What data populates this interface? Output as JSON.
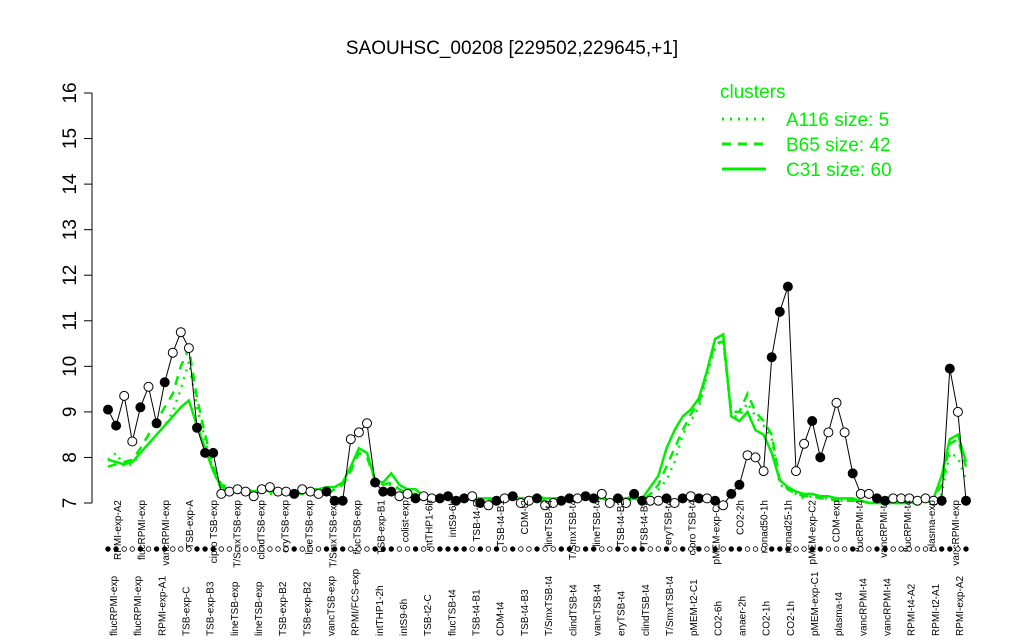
{
  "chart_data": {
    "type": "line",
    "title": "SAOUHSC_00208 [229502,229645,+1]",
    "ylim": [
      7,
      16
    ],
    "yticks": [
      7,
      8,
      9,
      10,
      11,
      12,
      13,
      14,
      15,
      16
    ],
    "legend": {
      "title": "clusters",
      "placement": "top-right",
      "entries": [
        {
          "label": "A116 size: 5",
          "style": "dotted"
        },
        {
          "label": "B65 size: 42",
          "style": "dashed"
        },
        {
          "label": "C31 size: 60",
          "style": "solid"
        }
      ],
      "color": "#00ee00"
    },
    "top_labels": [
      "RPMI-exp-A2",
      "flucRPMI-exp",
      "vancRPMI-exp",
      "TSB-exp-A",
      "cipro TSB-exp",
      "T/SmxTSB-exp",
      "clindTSB-exp",
      "eryTSB-exp",
      "lineTSB-exp",
      "T/SmxTSB-exp",
      "flucTSB-exp",
      "TSB-exp-B1",
      "colist-exp",
      "intTHP1-6h",
      "intS9-6h",
      "TSB-t4-C",
      "TSB-t4-B1",
      "CDM-t2",
      "lineTSB-t4",
      "T/SmxTSB-t4",
      "lineTSB-t4",
      "TSB-t4-B2",
      "TSB-t4-B3",
      "eryTSB-t4",
      "cipro TSB-t4",
      "pMEM-exp-C1",
      "CO2-2h",
      "nonad50-1h",
      "nonad25-1h",
      "pMEM-exp-C2",
      "CDM-exp",
      "flucRPMI-t4",
      "vancRPMI-t4",
      "flucRPMI-t4",
      "plasma-exp",
      "vancRPMI-exp"
    ],
    "bottom_labels": [
      "flucRPMI-exp",
      "flucRPMI-exp",
      "RPMI-exp-A1",
      "TSB-exp-C",
      "TSB-exp-B3",
      "lineTSB-exp",
      "lineTSB-exp",
      "TSB-exp-B2",
      "TSB-exp-B2",
      "vancTSB-exp",
      "RPMI/FCS-exp",
      "intTHP1-2h",
      "intS9-6h",
      "TSB-t2-C",
      "flucTSB-t4",
      "TSB-t4-B1",
      "CDM-t4",
      "TSB-t4-B3",
      "T/SmxTSB-t4",
      "clindTSB-t4",
      "vancTSB-t4",
      "eryTSB-t4",
      "clindTSB-t4",
      "T/SmxTSB-t4",
      "pMEM-t2-C1",
      "CO2-6h",
      "anaer-2h",
      "CO2-1h",
      "CO2-1h",
      "pMEM-exp-C1",
      "plasma-t4",
      "vancRPMI-t4",
      "vancRPMI-t4",
      "RPMI-t4-A2",
      "RPMI-t2-A1",
      "RPMI-exp-A2"
    ],
    "x": [
      1,
      2,
      3,
      4,
      5,
      6,
      7,
      8,
      9,
      10,
      11,
      12,
      13,
      14,
      15,
      16,
      17,
      18,
      19,
      20,
      21,
      22,
      23,
      24,
      25,
      26,
      27,
      28,
      29,
      30,
      31,
      32,
      33,
      34,
      35,
      36,
      37,
      38,
      39,
      40,
      41,
      42,
      43,
      44,
      45,
      46,
      47,
      48,
      49,
      50,
      51,
      52,
      53,
      54,
      55,
      56,
      57,
      58,
      59,
      60,
      61,
      62,
      63,
      64,
      65,
      66,
      67,
      68,
      69,
      70,
      71,
      72,
      73,
      74,
      75,
      76,
      77,
      78,
      79,
      80,
      81,
      82,
      83,
      84,
      85,
      86,
      87,
      88,
      89,
      90,
      91,
      92,
      93,
      94,
      95,
      96,
      97,
      98,
      99,
      100,
      101,
      102,
      103,
      104,
      105,
      106,
      107
    ],
    "sample_values": [
      9.05,
      8.7,
      9.35,
      8.35,
      9.1,
      9.55,
      8.75,
      9.65,
      10.3,
      10.75,
      10.4,
      8.65,
      8.1,
      8.1,
      7.2,
      7.25,
      7.3,
      7.25,
      7.15,
      7.3,
      7.35,
      7.25,
      7.25,
      7.2,
      7.3,
      7.25,
      7.2,
      7.25,
      7.05,
      7.05,
      8.4,
      8.55,
      8.75,
      7.45,
      7.25,
      7.25,
      7.15,
      7.2,
      7.1,
      7.15,
      7.1,
      7.1,
      7.15,
      7.05,
      7.1,
      7.15,
      7.0,
      6.95,
      7.05,
      7.1,
      7.15,
      7.0,
      7.05,
      7.1,
      6.95,
      7.0,
      7.05,
      7.1,
      7.1,
      7.15,
      7.1,
      7.2,
      7.0,
      7.1,
      7.0,
      7.2,
      7.05,
      7.05,
      7.05,
      7.1,
      7.0,
      7.1,
      7.15,
      7.1,
      7.1,
      7.05,
      6.95,
      7.2,
      7.4,
      8.05,
      8.0,
      7.7,
      10.2,
      11.2,
      11.75,
      7.7,
      8.3,
      8.8,
      8.0,
      8.55,
      9.2,
      8.55,
      7.65,
      7.2,
      7.2,
      7.1,
      7.05,
      7.1,
      7.1,
      7.1,
      7.05,
      7.1,
      7.05,
      7.05,
      9.95,
      9.0,
      7.05
    ],
    "series": [
      {
        "name": "A116 size: 5",
        "style": "dotted",
        "values": [
          7.95,
          8.1,
          7.8,
          7.85,
          8.1,
          8.3,
          8.5,
          8.7,
          9.0,
          9.5,
          10.1,
          9.1,
          8.4,
          7.7,
          7.3,
          7.3,
          7.25,
          7.25,
          7.2,
          7.25,
          7.2,
          7.2,
          7.2,
          7.2,
          7.2,
          7.2,
          7.2,
          7.2,
          7.3,
          7.4,
          7.7,
          8.2,
          8.1,
          7.5,
          7.4,
          7.4,
          7.3,
          7.2,
          7.2,
          7.1,
          7.1,
          7.1,
          7.1,
          7.1,
          7.05,
          7.05,
          7.05,
          7.05,
          7.1,
          7.05,
          7.1,
          7.05,
          7.05,
          7.1,
          7.05,
          7.05,
          7.05,
          7.1,
          7.05,
          7.1,
          7.1,
          7.1,
          7.05,
          7.05,
          7.05,
          7.1,
          7.05,
          7.2,
          7.3,
          7.5,
          7.9,
          8.5,
          8.8,
          9.1,
          9.8,
          10.4,
          10.6,
          8.9,
          8.9,
          9.2,
          8.9,
          8.7,
          8.4,
          7.4,
          7.3,
          7.2,
          7.1,
          7.15,
          7.1,
          7.1,
          7.05,
          7.05,
          7.05,
          7.05,
          7.0,
          7.0,
          7.0,
          7.0,
          7.0,
          7.0,
          7.0,
          7.05,
          7.0,
          7.2,
          8.1,
          8.0,
          7.5
        ]
      },
      {
        "name": "B65 size: 42",
        "style": "dashed",
        "values": [
          7.8,
          7.85,
          7.9,
          7.95,
          8.2,
          8.5,
          8.8,
          9.1,
          9.4,
          10.0,
          10.4,
          9.3,
          8.5,
          7.8,
          7.4,
          7.35,
          7.3,
          7.3,
          7.25,
          7.3,
          7.25,
          7.2,
          7.25,
          7.2,
          7.2,
          7.2,
          7.2,
          7.2,
          7.3,
          7.4,
          7.7,
          8.1,
          8.0,
          7.5,
          7.4,
          7.45,
          7.3,
          7.2,
          7.2,
          7.1,
          7.1,
          7.1,
          7.1,
          7.1,
          7.05,
          7.05,
          7.05,
          7.05,
          7.1,
          7.05,
          7.1,
          7.05,
          7.05,
          7.1,
          7.05,
          7.05,
          7.05,
          7.1,
          7.05,
          7.1,
          7.1,
          7.1,
          7.05,
          7.05,
          7.05,
          7.1,
          7.05,
          7.2,
          7.4,
          7.8,
          8.2,
          8.6,
          8.95,
          9.2,
          9.9,
          10.5,
          10.55,
          9.0,
          9.0,
          9.4,
          9.0,
          8.8,
          8.5,
          7.5,
          7.3,
          7.2,
          7.15,
          7.15,
          7.1,
          7.1,
          7.05,
          7.05,
          7.05,
          7.05,
          7.0,
          7.0,
          7.0,
          7.0,
          7.0,
          7.0,
          7.05,
          7.05,
          7.1,
          7.4,
          8.3,
          8.4,
          7.8
        ]
      },
      {
        "name": "C31 size: 60",
        "style": "solid",
        "values": [
          7.95,
          7.9,
          7.85,
          7.9,
          8.1,
          8.3,
          8.5,
          8.7,
          8.9,
          9.1,
          9.25,
          8.7,
          8.2,
          7.7,
          7.35,
          7.3,
          7.3,
          7.3,
          7.25,
          7.3,
          7.25,
          7.25,
          7.25,
          7.25,
          7.25,
          7.3,
          7.3,
          7.35,
          7.35,
          7.45,
          7.8,
          8.2,
          8.1,
          7.5,
          7.45,
          7.65,
          7.4,
          7.3,
          7.3,
          7.15,
          7.15,
          7.15,
          7.1,
          7.1,
          7.1,
          7.1,
          7.1,
          7.1,
          7.1,
          7.05,
          7.15,
          7.1,
          7.1,
          7.15,
          7.1,
          7.1,
          7.1,
          7.1,
          7.1,
          7.1,
          7.1,
          7.1,
          7.05,
          7.1,
          7.1,
          7.15,
          7.1,
          7.35,
          7.6,
          8.2,
          8.6,
          8.9,
          9.05,
          9.3,
          9.9,
          10.6,
          10.7,
          8.9,
          8.8,
          9.0,
          8.6,
          8.5,
          8.1,
          7.5,
          7.35,
          7.25,
          7.2,
          7.2,
          7.15,
          7.15,
          7.1,
          7.1,
          7.1,
          7.05,
          7.0,
          7.0,
          7.0,
          7.0,
          7.0,
          7.0,
          7.05,
          7.05,
          7.1,
          7.6,
          8.4,
          8.5,
          7.9
        ]
      }
    ],
    "marker_fill": [
      1,
      1,
      0,
      0,
      1,
      0,
      1,
      1,
      0,
      0,
      0,
      1,
      1,
      1,
      0,
      0,
      0,
      0,
      0,
      0,
      0,
      0,
      0,
      1,
      0,
      0,
      0,
      1,
      1,
      1,
      0,
      0,
      0,
      1,
      1,
      1,
      0,
      0,
      1,
      0,
      0,
      1,
      1,
      1,
      1,
      0,
      1,
      0,
      1,
      0,
      1,
      0,
      0,
      1,
      0,
      0,
      1,
      1,
      0,
      1,
      1,
      0,
      0,
      1,
      0,
      1,
      1,
      0,
      0,
      1,
      0,
      1,
      0,
      1,
      0,
      1,
      0,
      1,
      1,
      0,
      0,
      0,
      1,
      1,
      1,
      0,
      0,
      1,
      1,
      0,
      0,
      0,
      1,
      0,
      0,
      1,
      1,
      0,
      0,
      0,
      0,
      0,
      0,
      1,
      1,
      0,
      1
    ]
  }
}
